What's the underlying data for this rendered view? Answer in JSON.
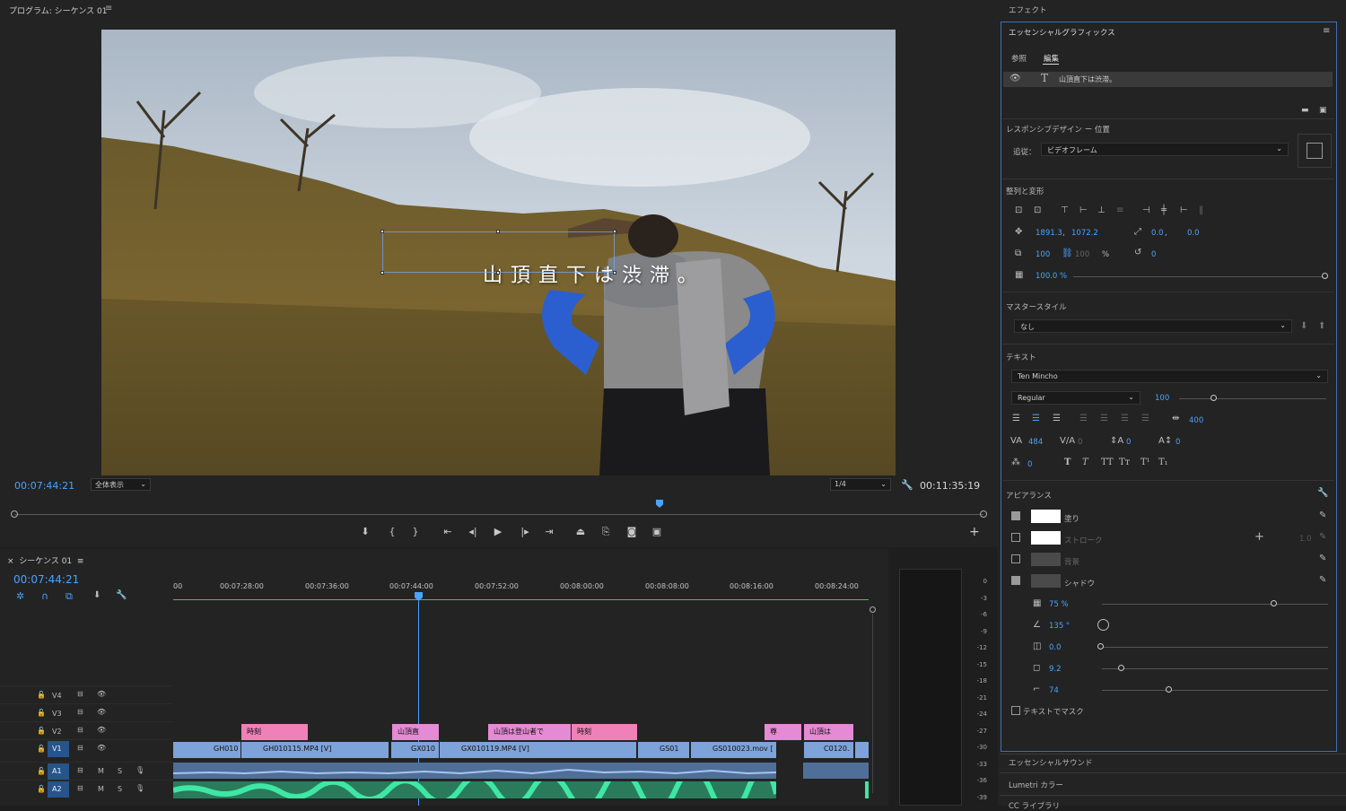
{
  "program": {
    "title": "プログラム: シーケンス 01",
    "menu_icon": "hamburger-icon",
    "overlay_text": "山頂直下は渋滞。",
    "timecode_current": "00:07:44:21",
    "fit_option": "全体表示",
    "resolution_option": "1/4",
    "timecode_duration": "00:11:35:19"
  },
  "timeline": {
    "tab_label": "シーケンス 01",
    "timecode": "00:07:44:21",
    "ruler_labels": [
      "00",
      "00:07:28:00",
      "00:07:36:00",
      "00:07:44:00",
      "00:07:52:00",
      "00:08:00:00",
      "00:08:08:00",
      "00:08:16:00",
      "00:08:24:00"
    ],
    "tracks": [
      {
        "name": "V4",
        "m": "",
        "s": ""
      },
      {
        "name": "V3",
        "m": "",
        "s": ""
      },
      {
        "name": "V2",
        "m": "",
        "s": ""
      },
      {
        "name": "V1",
        "m": "",
        "s": ""
      },
      {
        "name": "A1",
        "m": "M",
        "s": "S"
      },
      {
        "name": "A2",
        "m": "M",
        "s": "S"
      }
    ],
    "v2_clips": [
      "時刻",
      "山頂直",
      "山頂は登山者で",
      "時刻",
      "尊",
      "山頂は"
    ],
    "v1_clips": [
      "GH010",
      "GH010115.MP4 [V]",
      "GX010",
      "GX010119.MP4 [V]",
      "GS01",
      "GS010023.mov [",
      "C0120."
    ],
    "meter_scale": [
      "0",
      "-3",
      "-6",
      "-9",
      "-12",
      "-15",
      "-18",
      "-21",
      "-24",
      "-27",
      "-30",
      "-33",
      "-36",
      "-39"
    ]
  },
  "right": {
    "effects_label": "エフェクト",
    "eg_title": "エッセンシャルグラフィックス",
    "tab_browse": "参照",
    "tab_edit": "編集",
    "layer_name": "山頂直下は渋滞。",
    "responsive_label": "レスポンシブデザイン ー 位置",
    "follow_label": "追従：",
    "follow_value": "ビデオフレーム",
    "align_label": "整列と変形",
    "pos_x": "1891.3",
    "pos_y": "1072.2",
    "anchor_x": "0.0",
    "anchor_y": "0.0",
    "scale": "100",
    "scale_h": "100",
    "scale_unit": "%",
    "rotation": "0",
    "opacity": "100.0 %",
    "master_label": "マスタースタイル",
    "master_value": "なし",
    "text_label": "テキスト",
    "font": "Ten Mincho",
    "font_style": "Regular",
    "font_size": "100",
    "tracking": "400",
    "kerning": "484",
    "va": "0",
    "leading": "0",
    "baseline": "0",
    "tsume": "0",
    "appearance_label": "アピアランス",
    "fill_label": "塗り",
    "stroke_label": "ストローク",
    "stroke_value": "1.0",
    "bg_label": "背景",
    "shadow_label": "シャドウ",
    "shadow_opacity": "75 %",
    "shadow_angle": "135 °",
    "shadow_distance": "0.0",
    "shadow_size": "9.2",
    "shadow_blur": "74",
    "mask_label": "テキストでマスク",
    "essential_sound": "エッセンシャルサウンド",
    "lumetri": "Lumetri カラー",
    "cc_library": "CC ライブラリ"
  },
  "colors": {
    "accent": "#4aa3ff",
    "clip_pink": "#e98ad6",
    "clip_blue": "#7ea3d8",
    "audio_green": "#2fc48e"
  }
}
